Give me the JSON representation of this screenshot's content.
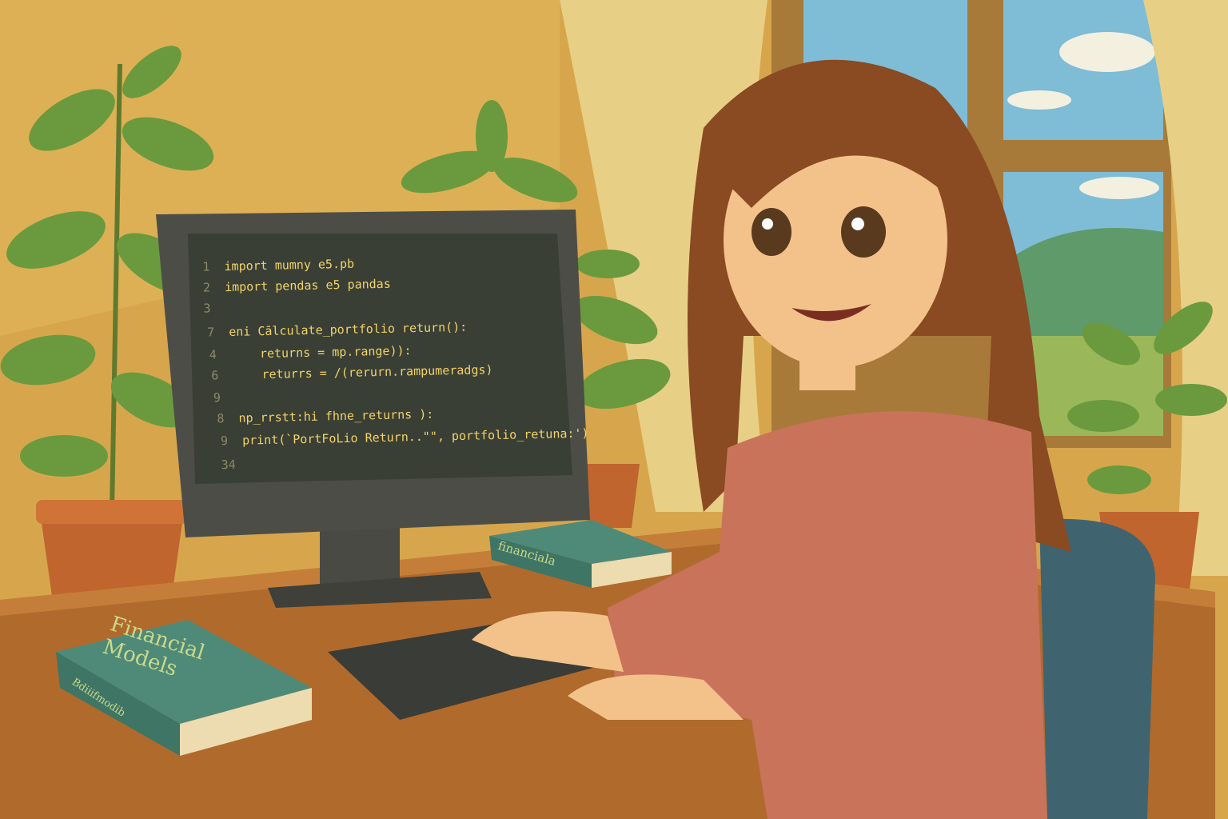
{
  "code_editor": {
    "lines": [
      {
        "n": "1",
        "text": "import mumny e5.pb"
      },
      {
        "n": "2",
        "text": "import pendas e5 pandas"
      },
      {
        "n": "3",
        "text": ""
      },
      {
        "n": "7",
        "text": "eni Cālculate_portfolio return():"
      },
      {
        "n": "4",
        "text": "returns = mp.range)):"
      },
      {
        "n": "6",
        "text": "returrs = /(rerurn.rampumeradgs)"
      },
      {
        "n": "9",
        "text": ""
      },
      {
        "n": "8",
        "text": "np_rrstt:hi fhne_returns ):"
      },
      {
        "n": "9",
        "text": "print(`PortFoLio Return..\"\", portfolio_retuna:')"
      },
      {
        "n": "34",
        "text": ""
      }
    ]
  },
  "books": {
    "front_title": "Financial Models",
    "front_spine": "Bdiiifmodib",
    "back_title": "financiala"
  },
  "colors": {
    "wall": "#d9a94e",
    "screen": "#3a3f35",
    "code": "#f2d36a",
    "sweater": "#c9735a",
    "hair": "#8a4a22",
    "book": "#4f8a78"
  }
}
